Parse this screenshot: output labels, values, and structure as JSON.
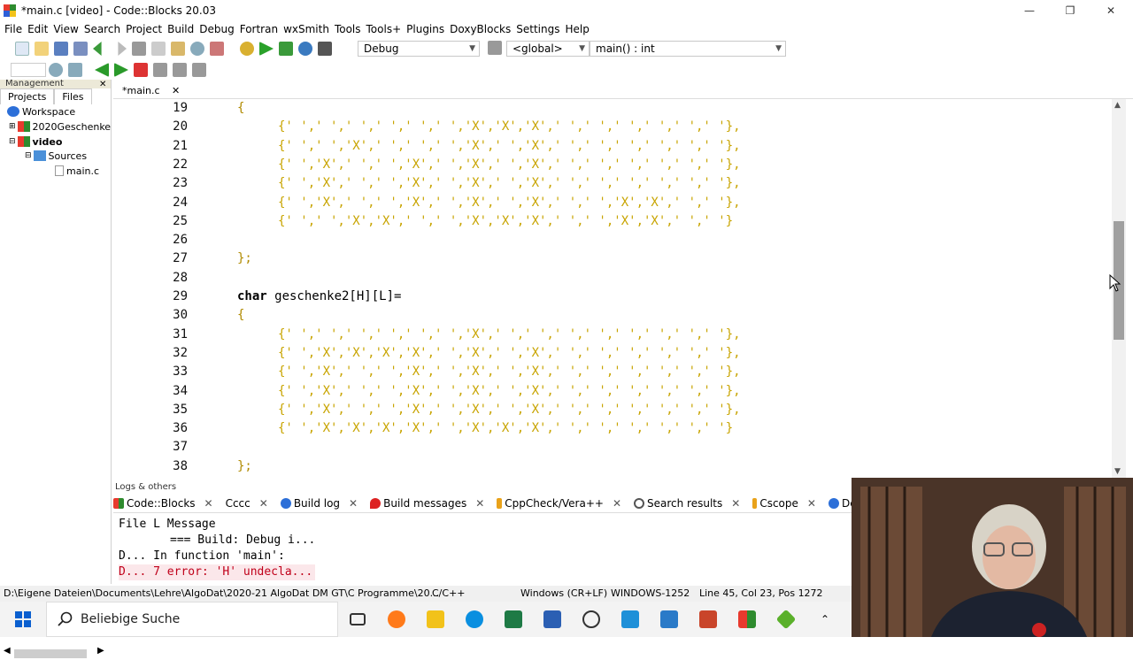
{
  "window": {
    "title": "*main.c [video] - Code::Blocks 20.03"
  },
  "menu": [
    "File",
    "Edit",
    "View",
    "Search",
    "Project",
    "Build",
    "Debug",
    "Fortran",
    "wxSmith",
    "Tools",
    "Tools+",
    "Plugins",
    "DoxyBlocks",
    "Settings",
    "Help"
  ],
  "toolbar": {
    "build_target": "Debug",
    "scope": "<global>",
    "function": "main() : int"
  },
  "management": {
    "header": "Management",
    "tabs": [
      "Projects",
      "Files"
    ],
    "tree": {
      "workspace": "Workspace",
      "project1": "2020Geschenke",
      "project2": "video",
      "folder": "Sources",
      "file": "main.c"
    }
  },
  "editor": {
    "tab": "*main.c",
    "lines": [
      {
        "n": "19",
        "t": "brace",
        "s": "{"
      },
      {
        "n": "20",
        "t": "row",
        "s": "{' ',' ',' ',' ',' ',' ','X','X','X',' ',' ',' ',' ',' ',' '},"
      },
      {
        "n": "21",
        "t": "row",
        "s": "{' ',' ','X',' ',' ',' ','X',' ','X',' ',' ',' ',' ',' ',' '},"
      },
      {
        "n": "22",
        "t": "row",
        "s": "{' ','X',' ',' ','X',' ','X',' ','X',' ',' ',' ',' ',' ',' '},"
      },
      {
        "n": "23",
        "t": "row",
        "s": "{' ','X',' ',' ','X',' ','X',' ','X',' ',' ',' ',' ',' ',' '},"
      },
      {
        "n": "24",
        "t": "row",
        "s": "{' ','X',' ',' ','X',' ','X',' ','X',' ',' ','X','X',' ',' '},"
      },
      {
        "n": "25",
        "t": "row",
        "s": "{' ',' ','X','X',' ',' ','X','X','X',' ',' ','X','X',' ',' '}"
      },
      {
        "n": "26",
        "t": "blank",
        "s": ""
      },
      {
        "n": "27",
        "t": "end",
        "s": "};"
      },
      {
        "n": "28",
        "t": "blank",
        "s": ""
      },
      {
        "n": "29",
        "t": "decl",
        "kw": "char",
        "s": " geschenke2[H][L]="
      },
      {
        "n": "30",
        "t": "brace",
        "s": "{"
      },
      {
        "n": "31",
        "t": "row",
        "s": "{' ',' ',' ',' ',' ',' ','X',' ',' ',' ',' ',' ',' ',' ',' '},"
      },
      {
        "n": "32",
        "t": "row",
        "s": "{' ','X','X','X','X',' ','X',' ','X',' ',' ',' ',' ',' ',' '},"
      },
      {
        "n": "33",
        "t": "row",
        "s": "{' ','X',' ',' ','X',' ','X',' ','X',' ',' ',' ',' ',' ',' '},"
      },
      {
        "n": "34",
        "t": "row",
        "s": "{' ','X',' ',' ','X',' ','X',' ','X',' ',' ',' ',' ',' ',' '},"
      },
      {
        "n": "35",
        "t": "row",
        "s": "{' ','X',' ',' ','X',' ','X',' ','X',' ',' ',' ',' ',' ',' '},"
      },
      {
        "n": "36",
        "t": "row",
        "s": "{' ','X','X','X','X',' ','X','X','X',' ',' ',' ',' ',' ',' '}"
      },
      {
        "n": "37",
        "t": "blank",
        "s": ""
      },
      {
        "n": "38",
        "t": "end",
        "s": "};"
      }
    ]
  },
  "logs": {
    "header": "Logs & others",
    "tabs": [
      "Code::Blocks",
      "Cccc",
      "Build log",
      "Build messages",
      "CppCheck/Vera++",
      "Search results",
      "Cscope",
      "Debug"
    ],
    "col_headers": "File L Message",
    "messages": [
      "=== Build: Debug i...",
      "D...  In function 'main':",
      "D... 7 error: 'H' undecla..."
    ]
  },
  "status": {
    "path": "D:\\Eigene Dateien\\Documents\\Lehre\\AlgoDat\\2020-21 AlgoDat DM GT\\C Programme\\20...",
    "language": "C/C++",
    "eol": "Windows (CR+LF)",
    "encoding": "WINDOWS-1252",
    "position": "Line 45, Col 23, Pos 1272"
  },
  "taskbar": {
    "search_placeholder": "Beliebige Suche"
  },
  "colors": {
    "char_literal": "#c8a400",
    "error_bg": "#fbe7ea",
    "error_text": "#c0001a"
  }
}
